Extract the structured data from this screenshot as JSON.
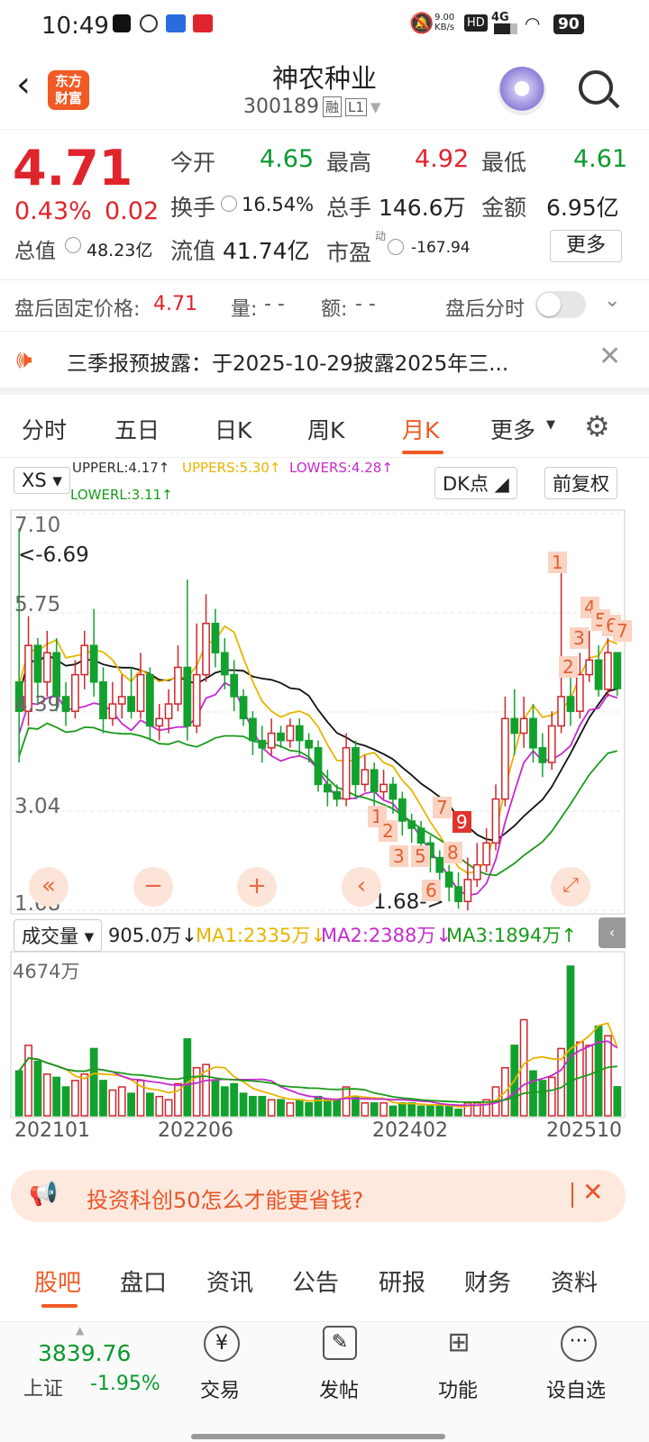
{
  "status": {
    "time": "10:49",
    "net_speed": "9.00\nKB/s",
    "hd": "HD",
    "signal": "4G",
    "battery": "90"
  },
  "nav": {
    "name": "神农种业",
    "code": "300189",
    "rong": "融",
    "level": "L1",
    "brand_line1": "东方",
    "brand_line2": "财富"
  },
  "quote": {
    "price": "4.71",
    "pct": "0.43%",
    "chg": "0.02",
    "open_label": "今开",
    "open": "4.65",
    "high_label": "最高",
    "high": "4.92",
    "low_label": "最低",
    "low": "4.61",
    "turnover_label": "换手",
    "turnover": "16.54%",
    "volume_label": "总手",
    "volume": "146.6万",
    "amount_label": "金额",
    "amount": "6.95亿",
    "mktcap_label": "总值",
    "mktcap": "48.23亿",
    "float_label": "流值",
    "float": "41.74亿",
    "pe_label": "市盈",
    "pe_sup": "动",
    "pe": "-167.94",
    "more": "更多"
  },
  "after": {
    "fixed_label": "盘后固定价格:",
    "fixed": "4.71",
    "vol_label": "量:",
    "vol": "- -",
    "amt_label": "额:",
    "amt": "- -",
    "timeshare": "盘后分时"
  },
  "notice": {
    "text": "三季报预披露：于2025-10-29披露2025年三..."
  },
  "ktabs": [
    "分时",
    "五日",
    "日K",
    "周K",
    "月K",
    "更多"
  ],
  "ind": {
    "xs": "XS",
    "upperl": "UPPERL:4.17↑",
    "uppers": "UPPERS:5.30↑",
    "lowers": "LOWERS:4.28↑",
    "lowerl": "LOWERL:3.11↑",
    "dk": "DK点",
    "fq": "前复权"
  },
  "price_axis": {
    "y1": "7.10",
    "y2": "5.75",
    "y3": "4.39",
    "y4": "3.04",
    "y5": "1.68",
    "max_mark": "<-6.69",
    "min_mark": "1.68->"
  },
  "vol_ind": {
    "label": "成交量",
    "val": "905.0万↓",
    "ma1": "MA1:2335万↓",
    "ma2": "MA2:2388万↓",
    "ma3": "MA3:1894万↑",
    "top": "4674万"
  },
  "dates": [
    "202101",
    "202206",
    "202402",
    "202510"
  ],
  "promo": {
    "text": "投资科创50怎么才能更省钱?"
  },
  "bottomtabs": [
    "股吧",
    "盘口",
    "资讯",
    "公告",
    "研报",
    "财务",
    "资料"
  ],
  "dock": {
    "index": "3839.76",
    "index_name": "上证",
    "index_pct": "-1.95%",
    "trade": "交易",
    "post": "发帖",
    "func": "功能",
    "watch": "设自选"
  },
  "chart_data": {
    "type": "candlestick",
    "period": "monthly",
    "ylim": [
      1.68,
      7.1
    ],
    "candles": [
      [
        4.8,
        4.4,
        6.9,
        3.7
      ],
      [
        4.4,
        5.3,
        5.7,
        4.2
      ],
      [
        5.3,
        4.8,
        5.4,
        4.5
      ],
      [
        4.8,
        5.2,
        5.5,
        4.6
      ],
      [
        5.2,
        4.6,
        5.4,
        4.4
      ],
      [
        4.6,
        4.4,
        4.8,
        4.2
      ],
      [
        4.4,
        4.9,
        5.1,
        4.3
      ],
      [
        4.9,
        5.3,
        5.5,
        4.7
      ],
      [
        5.3,
        4.8,
        5.8,
        4.6
      ],
      [
        4.8,
        4.3,
        5.0,
        4.1
      ],
      [
        4.3,
        4.5,
        4.8,
        4.2
      ],
      [
        4.5,
        4.6,
        4.9,
        4.3
      ],
      [
        4.6,
        4.4,
        5.0,
        4.3
      ],
      [
        4.4,
        4.9,
        5.2,
        4.3
      ],
      [
        4.9,
        4.2,
        5.0,
        4.0
      ],
      [
        4.2,
        4.3,
        4.5,
        4.0
      ],
      [
        4.3,
        4.5,
        4.7,
        4.1
      ],
      [
        4.5,
        5.0,
        5.3,
        4.4
      ],
      [
        5.0,
        4.2,
        6.2,
        4.0
      ],
      [
        4.2,
        4.9,
        5.6,
        4.1
      ],
      [
        4.9,
        5.6,
        6.0,
        4.8
      ],
      [
        5.6,
        5.2,
        5.8,
        5.0
      ],
      [
        5.2,
        4.9,
        5.4,
        4.7
      ],
      [
        4.9,
        4.6,
        5.1,
        4.4
      ],
      [
        4.6,
        4.3,
        4.7,
        4.2
      ],
      [
        4.3,
        4.0,
        4.4,
        3.8
      ],
      [
        4.0,
        3.9,
        4.2,
        3.7
      ],
      [
        3.9,
        4.1,
        4.3,
        3.8
      ],
      [
        4.1,
        4.0,
        4.2,
        3.9
      ],
      [
        4.0,
        4.2,
        4.3,
        3.9
      ],
      [
        4.2,
        4.0,
        4.3,
        3.8
      ],
      [
        4.0,
        3.9,
        4.1,
        3.7
      ],
      [
        3.9,
        3.4,
        4.0,
        3.3
      ],
      [
        3.4,
        3.3,
        3.6,
        3.1
      ],
      [
        3.3,
        3.2,
        3.4,
        3.1
      ],
      [
        3.2,
        3.9,
        4.1,
        3.1
      ],
      [
        3.9,
        3.4,
        4.0,
        3.2
      ],
      [
        3.4,
        3.6,
        3.8,
        3.3
      ],
      [
        3.6,
        3.3,
        3.7,
        3.1
      ],
      [
        3.3,
        3.4,
        3.6,
        3.2
      ],
      [
        3.4,
        3.2,
        3.5,
        3.0
      ],
      [
        3.2,
        2.9,
        3.3,
        2.7
      ],
      [
        2.9,
        2.8,
        3.0,
        2.6
      ],
      [
        2.8,
        2.6,
        2.9,
        2.4
      ],
      [
        2.6,
        2.4,
        2.7,
        2.2
      ],
      [
        2.4,
        2.2,
        2.5,
        2.0
      ],
      [
        2.2,
        2.0,
        2.3,
        1.8
      ],
      [
        2.0,
        1.8,
        2.2,
        1.7
      ],
      [
        1.8,
        2.1,
        2.4,
        1.68
      ],
      [
        2.1,
        2.3,
        2.6,
        2.0
      ],
      [
        2.3,
        2.6,
        2.8,
        2.2
      ],
      [
        2.6,
        3.2,
        3.4,
        2.5
      ],
      [
        3.2,
        4.3,
        4.6,
        3.1
      ],
      [
        4.3,
        4.1,
        4.7,
        3.8
      ],
      [
        4.1,
        4.3,
        4.6,
        3.9
      ],
      [
        4.3,
        3.9,
        4.5,
        3.7
      ],
      [
        3.9,
        3.7,
        4.1,
        3.5
      ],
      [
        3.7,
        4.2,
        4.4,
        3.6
      ],
      [
        4.2,
        4.6,
        6.3,
        4.1
      ],
      [
        4.6,
        4.4,
        5.1,
        4.2
      ],
      [
        4.4,
        4.9,
        5.2,
        4.3
      ],
      [
        4.9,
        5.1,
        5.5,
        4.8
      ],
      [
        5.1,
        4.7,
        5.3,
        4.6
      ],
      [
        4.7,
        5.2,
        5.4,
        4.6
      ],
      [
        5.2,
        4.71,
        4.92,
        4.61
      ]
    ],
    "volumes": [
      1400,
      2200,
      1700,
      1300,
      1200,
      900,
      1100,
      1300,
      2100,
      1100,
      800,
      900,
      700,
      1100,
      700,
      600,
      500,
      1000,
      2400,
      1500,
      1600,
      1100,
      900,
      1000,
      700,
      600,
      600,
      500,
      500,
      400,
      500,
      400,
      600,
      500,
      500,
      900,
      600,
      400,
      400,
      400,
      300,
      400,
      400,
      300,
      300,
      300,
      300,
      200,
      400,
      400,
      500,
      900,
      1500,
      2200,
      3000,
      1400,
      1100,
      1200,
      2100,
      4674,
      2300,
      2200,
      2800,
      2500,
      905
    ],
    "overlay_series": [
      "UPPERL",
      "UPPERS",
      "LOWERS",
      "LOWERL"
    ],
    "volume_ma": [
      "MA1",
      "MA2",
      "MA3"
    ]
  }
}
